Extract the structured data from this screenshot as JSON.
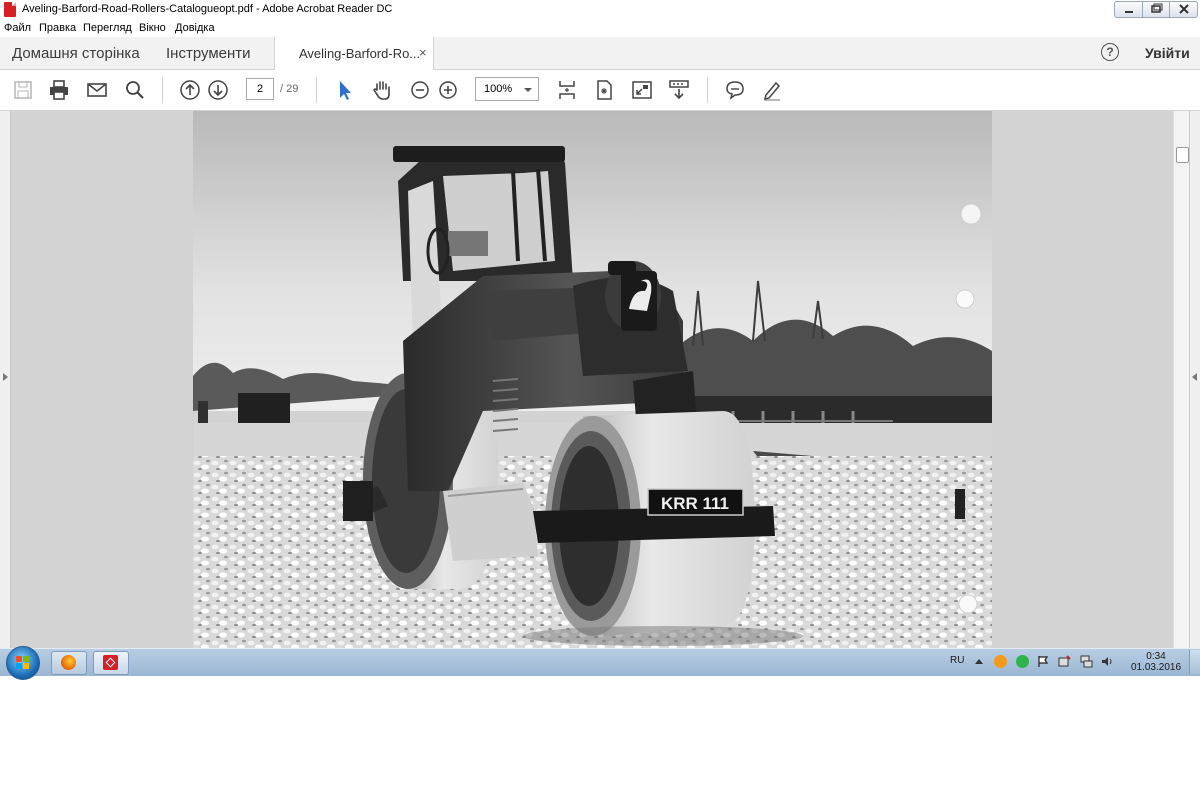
{
  "window": {
    "title": "Aveling-Barford-Road-Rollers-Catalogueopt.pdf - Adobe Acrobat Reader DC",
    "app_icon": "acrobat-icon",
    "controls": [
      "minimize-icon",
      "maximize-icon",
      "close-icon"
    ]
  },
  "menu": {
    "items": [
      "Файл",
      "Правка",
      "Перегляд",
      "Вікно",
      "Довідка"
    ]
  },
  "nav": {
    "home": "Домашня сторінка",
    "tools": "Інструменти",
    "doc_tab": "Aveling-Barford-Ro...",
    "doc_tab_close": "×",
    "help": "?",
    "sign_in": "Увійти"
  },
  "toolbar": {
    "page_current": "2",
    "page_total": "/ 29",
    "zoom": "100%",
    "icons": [
      "save-icon",
      "print-icon",
      "email-icon",
      "search-icon",
      "prev-page-icon",
      "next-page-icon",
      "select-cursor-icon",
      "hand-tool-icon",
      "zoom-out-icon",
      "zoom-in-icon",
      "fit-page-icon",
      "rotate-icon",
      "full-screen-icon",
      "scroll-mode-icon",
      "comment-icon",
      "sign-icon"
    ]
  },
  "document": {
    "page_image": "photo of Aveling-Barford road roller on gravel road",
    "plate_text": "KRR 111"
  },
  "taskbar": {
    "language": "RU",
    "time": "0:34",
    "date": "01.03.2016",
    "apps": [
      "firefox-icon",
      "acrobat-reader-icon"
    ]
  },
  "colors": {
    "acrobat_red": "#d71f26",
    "select_blue": "#2f6fd1",
    "taskbar_blue": "#a9c0d9"
  }
}
